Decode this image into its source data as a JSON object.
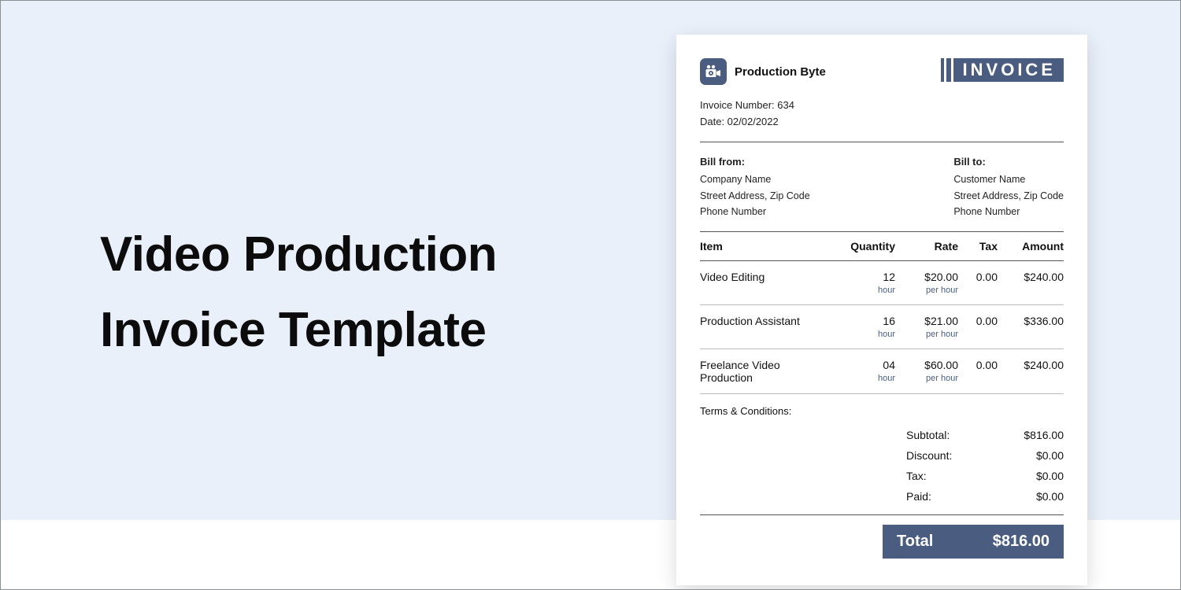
{
  "page": {
    "headline_line1": "Video Production",
    "headline_line2": "Invoice Template"
  },
  "colors": {
    "accent": "#4a5d80"
  },
  "invoice": {
    "brand_name": "Production Byte",
    "badge_label": "INVOICE",
    "meta": {
      "number_label": "Invoice Number: 634",
      "date_label": "Date: 02/02/2022"
    },
    "bill_from": {
      "heading": "Bill from:",
      "line1": "Company Name",
      "line2": "Street Address, Zip Code",
      "line3": "Phone Number"
    },
    "bill_to": {
      "heading": "Bill to:",
      "line1": "Customer Name",
      "line2": "Street Address, Zip Code",
      "line3": "Phone Number"
    },
    "columns": {
      "item": "Item",
      "qty": "Quantity",
      "rate": "Rate",
      "tax": "Tax",
      "amount": "Amount"
    },
    "rows": [
      {
        "item": "Video Editing",
        "qty": "12",
        "qty_unit": "hour",
        "rate": "$20.00",
        "rate_unit": "per hour",
        "tax": "0.00",
        "amount": "$240.00"
      },
      {
        "item": "Production Assistant",
        "qty": "16",
        "qty_unit": "hour",
        "rate": "$21.00",
        "rate_unit": "per hour",
        "tax": "0.00",
        "amount": "$336.00"
      },
      {
        "item": "Freelance Video Production",
        "qty": "04",
        "qty_unit": "hour",
        "rate": "$60.00",
        "rate_unit": "per hour",
        "tax": "0.00",
        "amount": "$240.00"
      }
    ],
    "terms_label": "Terms & Conditions:",
    "totals": {
      "subtotal_label": "Subtotal:",
      "subtotal_value": "$816.00",
      "discount_label": "Discount:",
      "discount_value": "$0.00",
      "tax_label": "Tax:",
      "tax_value": "$0.00",
      "paid_label": "Paid:",
      "paid_value": "$0.00",
      "grand_label": "Total",
      "grand_value": "$816.00"
    }
  }
}
